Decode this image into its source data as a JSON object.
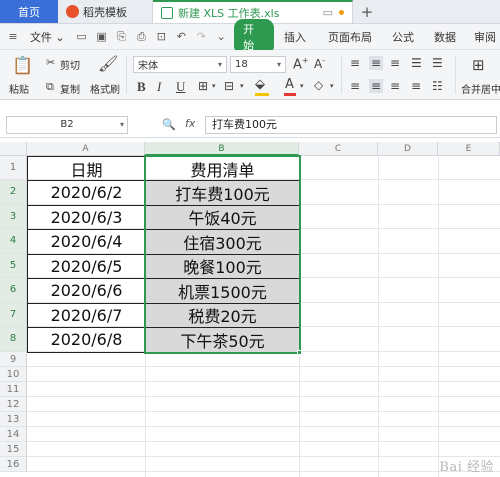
{
  "tabs": {
    "home": "首页",
    "wps_template": "稻壳模板",
    "document": "新建 XLS 工作表.xls"
  },
  "menu": {
    "file": "文件",
    "start": "开始",
    "insert": "插入",
    "page_layout": "页面布局",
    "formula": "公式",
    "data": "数据",
    "review": "审阅"
  },
  "ribbon": {
    "cut": "剪切",
    "copy": "复制",
    "paste": "粘贴",
    "format_painter": "格式刷",
    "font_name": "宋体",
    "font_size": "18",
    "merge_center": "合并居中",
    "bold": "B",
    "italic": "I",
    "underline": "U",
    "grow_font": "A⁺",
    "shrink_font": "A⁻",
    "font_color_swatch": "#e53935",
    "fill_color_swatch": "#f5c400"
  },
  "formula_bar": {
    "name_box": "B2",
    "fx": "fx",
    "content": "打车费100元"
  },
  "grid": {
    "columns": [
      "A",
      "B",
      "C",
      "D",
      "E"
    ],
    "rows": [
      "1",
      "2",
      "3",
      "4",
      "5",
      "6",
      "7",
      "8",
      "9",
      "10",
      "11",
      "12",
      "13",
      "14",
      "15",
      "16"
    ],
    "header_row": {
      "A": "日期",
      "B": "费用清单"
    },
    "data_rows": [
      {
        "A": "2020/6/2",
        "B": "打车费100元"
      },
      {
        "A": "2020/6/3",
        "B": "午饭40元"
      },
      {
        "A": "2020/6/4",
        "B": "住宿300元"
      },
      {
        "A": "2020/6/5",
        "B": "晚餐100元"
      },
      {
        "A": "2020/6/6",
        "B": "机票1500元"
      },
      {
        "A": "2020/6/7",
        "B": "税费20元"
      },
      {
        "A": "2020/6/8",
        "B": "下午茶50元"
      }
    ]
  },
  "watermark": "Bai 经验",
  "accent_color": "#2e9a4f"
}
